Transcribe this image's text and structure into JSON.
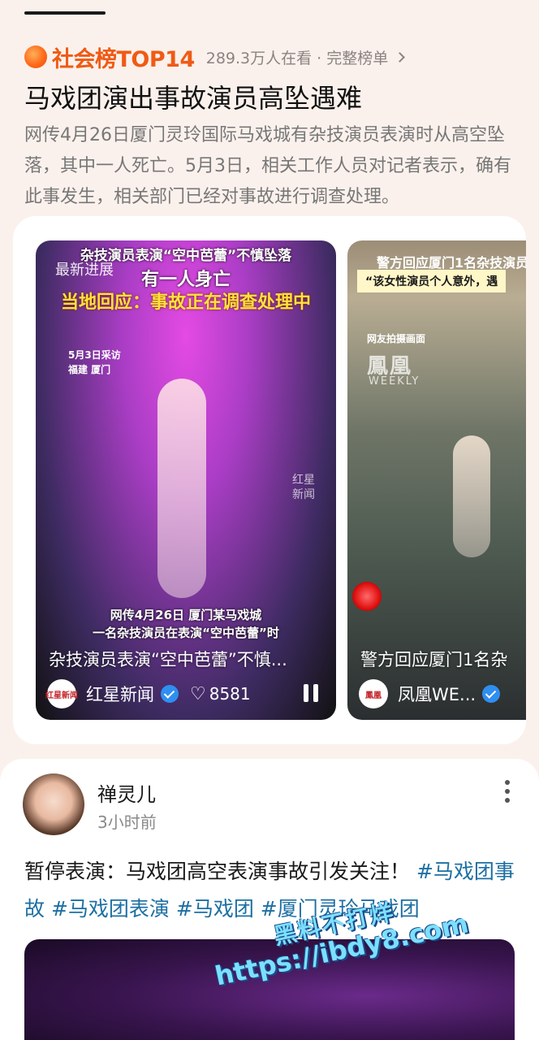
{
  "ranking": {
    "title": "社会榜TOP14",
    "meta": "289.3万人在看 · 完整榜单"
  },
  "news": {
    "headline": "马戏团演出事故演员高坠遇难",
    "summary": "网传4月26日厦门灵玲国际马戏城有杂技演员表演时从高空坠落，其中一人死亡。5月3日，相关工作人员对记者表示，确有此事发生，相关部门已经对事故进行调查处理。"
  },
  "videos": [
    {
      "overlay_top": "杂技演员表演“空中芭蕾”不慎坠落",
      "overlay_line2": "有一人身亡",
      "overlay_line3": "当地回应：事故正在调查处理中",
      "latest": "最新进展",
      "date_line1": "5月3日采访",
      "date_line2": "福建 厦门",
      "watermark_line1": "红星",
      "watermark_line2": "新闻",
      "bottom_line1": "网传4月26日 厦门某马戏城",
      "bottom_line2": "一名杂技演员在表演“空中芭蕾”时",
      "title": "杂技演员表演“空中芭蕾”不慎...",
      "source_logo": "红星新闻",
      "source": "红星新闻",
      "likes": "8581"
    },
    {
      "overlay_top": "警方回应厦门1名杂技演员",
      "overlay_quote": "“该女性演员个人意外，遇",
      "net_label": "网友拍摄画面",
      "logo_text": "鳳凰",
      "logo_sub": "WEEKLY",
      "title": "警方回应厦门1名杂",
      "source_logo": "鳳凰",
      "source": "凤凰WE..."
    }
  ],
  "post": {
    "author": "禅灵儿",
    "time": "3小时前",
    "text": "暂停表演：马戏团高空表演事故引发关注！",
    "tags": [
      "#马戏团事故",
      "#马戏团表演",
      "#马戏团",
      "#厦门灵玲马戏团"
    ]
  },
  "watermark": {
    "line1": "黑料不打烊",
    "line2": "https://ibdy8.com"
  }
}
